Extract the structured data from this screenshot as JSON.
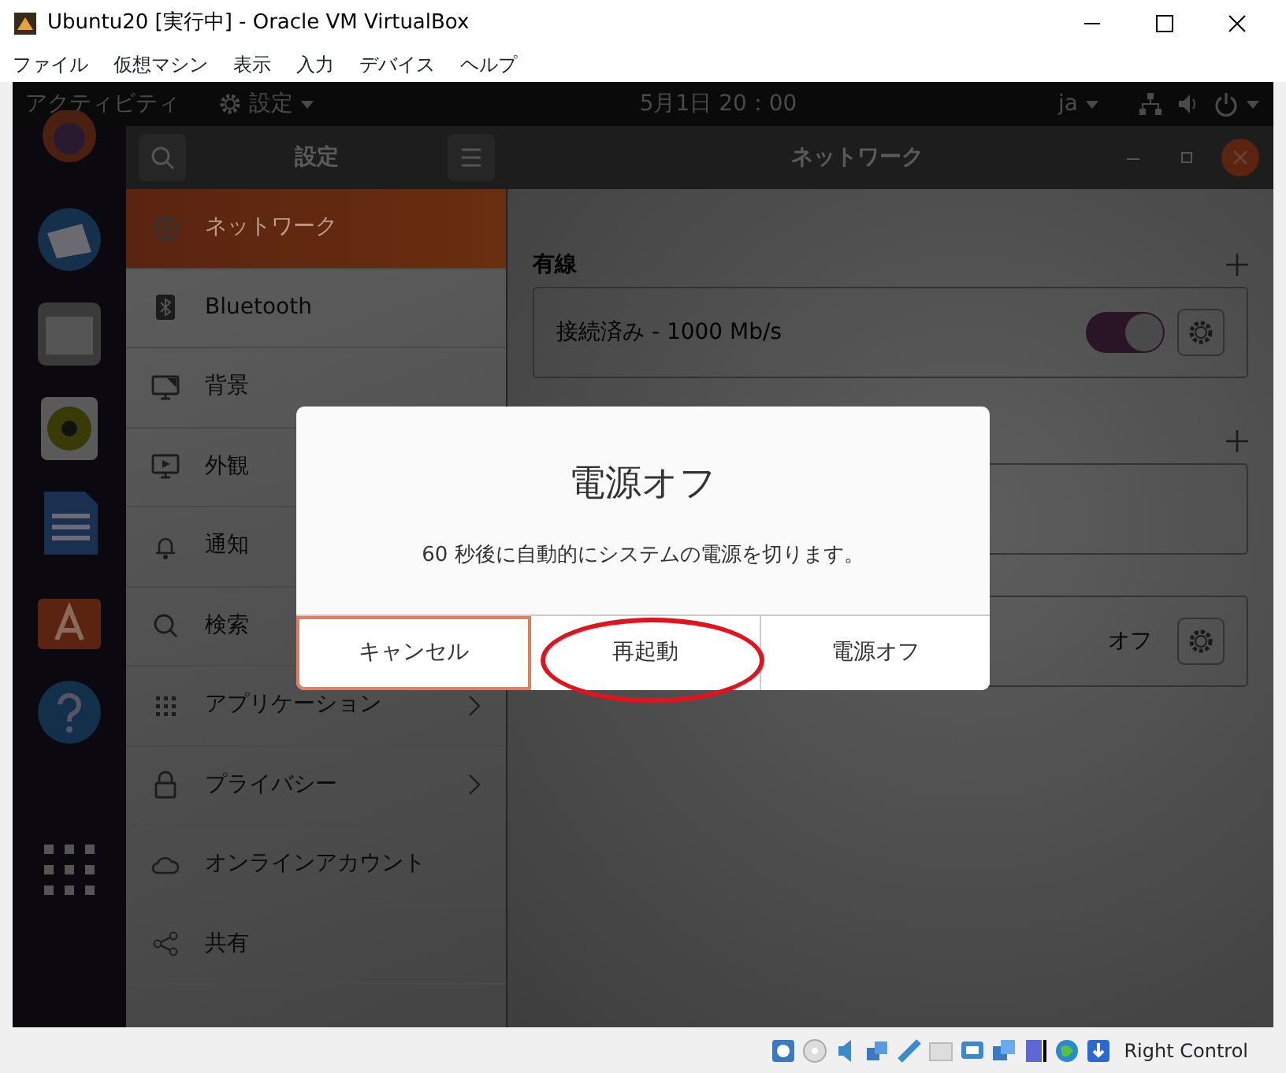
{
  "window": {
    "title": "Ubuntu20 [実行中] - Oracle VM VirtualBox"
  },
  "menu": [
    "ファイル",
    "仮想マシン",
    "表示",
    "入力",
    "デバイス",
    "ヘルプ"
  ],
  "top_bar": {
    "activities": "アクティビティ",
    "app_menu": "設定",
    "clock": "5月1日  20：00",
    "input_method": "ja"
  },
  "settings": {
    "title": "設定",
    "page_title": "ネットワーク",
    "sidebar": [
      {
        "label": "ネットワーク",
        "selected": true,
        "kind": "plain"
      },
      {
        "label": "Bluetooth",
        "selected": false,
        "kind": "plain"
      },
      {
        "label": "背景",
        "selected": false,
        "kind": "plain"
      },
      {
        "label": "外観",
        "selected": false,
        "kind": "plain"
      },
      {
        "label": "通知",
        "selected": false,
        "kind": "plain"
      },
      {
        "label": "検索",
        "selected": false,
        "kind": "plain"
      },
      {
        "label": "アプリケーション",
        "selected": false,
        "kind": "submenu"
      },
      {
        "label": "プライバシー",
        "selected": false,
        "kind": "submenu"
      },
      {
        "label": "オンラインアカウント",
        "selected": false,
        "kind": "plain"
      },
      {
        "label": "共有",
        "selected": false,
        "kind": "plain"
      }
    ],
    "sections": [
      {
        "heading": "有線",
        "rows": [
          {
            "kind": "switch",
            "label": "接続済み - 1000 Mb/s",
            "on": true
          }
        ]
      },
      {
        "rows": [
          {
            "kind": "empty"
          }
        ]
      },
      {
        "rows": [
          {
            "kind": "status",
            "status": "オフ"
          }
        ]
      }
    ]
  },
  "dialog": {
    "title": "電源オフ",
    "message": "60 秒後に自動的にシステムの電源を切ります。",
    "buttons": [
      {
        "label": "キャンセル",
        "focused": true,
        "circled": false
      },
      {
        "label": "再起動",
        "focused": false,
        "circled": true
      },
      {
        "label": "電源オフ",
        "focused": false,
        "circled": false
      }
    ]
  },
  "status_bar": {
    "host_key": "Right Control"
  }
}
